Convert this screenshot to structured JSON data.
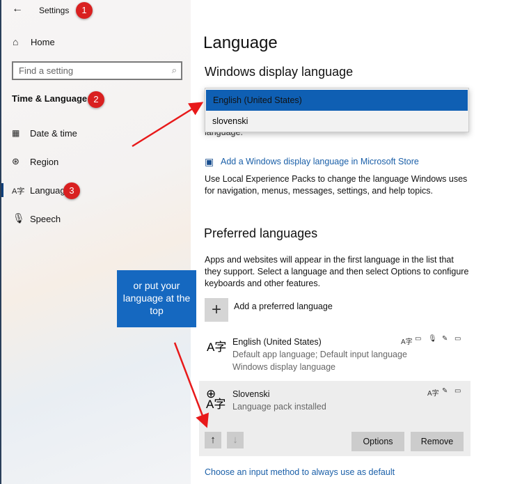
{
  "sidebar": {
    "back_icon": "back-arrow-icon",
    "title": "Settings",
    "home": "Home",
    "search_placeholder": "Find a setting",
    "section": "Time & Language",
    "items": [
      {
        "label": "Date & time",
        "icon": "calendar-clock-icon"
      },
      {
        "label": "Region",
        "icon": "globe-icon"
      },
      {
        "label": "Language",
        "icon": "language-icon",
        "active": true
      },
      {
        "label": "Speech",
        "icon": "microphone-icon"
      }
    ]
  },
  "annotations": {
    "badges": [
      "1",
      "2",
      "3"
    ],
    "callout": "or put your language at the top",
    "color": "#d92020",
    "callout_color": "#1568c0"
  },
  "main": {
    "title": "Language",
    "display_heading": "Windows display language",
    "dropdown": {
      "options": [
        "English (United States)",
        "slovenski"
      ],
      "selected": "English (United States)"
    },
    "hidden_text": "language.",
    "store_link": "Add a Windows display language in Microsoft Store",
    "lxp_text": "Use Local Experience Packs to change the language Windows uses for navigation, menus, messages, settings, and help topics.",
    "preferred_heading": "Preferred languages",
    "preferred_text": "Apps and websites will appear in the first language in the list that they support. Select a language and then select Options to configure keyboards and other features.",
    "add_label": "Add a preferred language",
    "languages": [
      {
        "name": "English (United States)",
        "line1": "Default app language; Default input language",
        "line2": "Windows display language"
      },
      {
        "name": "Slovenski",
        "line1": "Language pack installed"
      }
    ],
    "options_button": "Options",
    "remove_button": "Remove",
    "accent": "#0f5fb3",
    "input_method_link": "Choose an input method to always use as default"
  }
}
